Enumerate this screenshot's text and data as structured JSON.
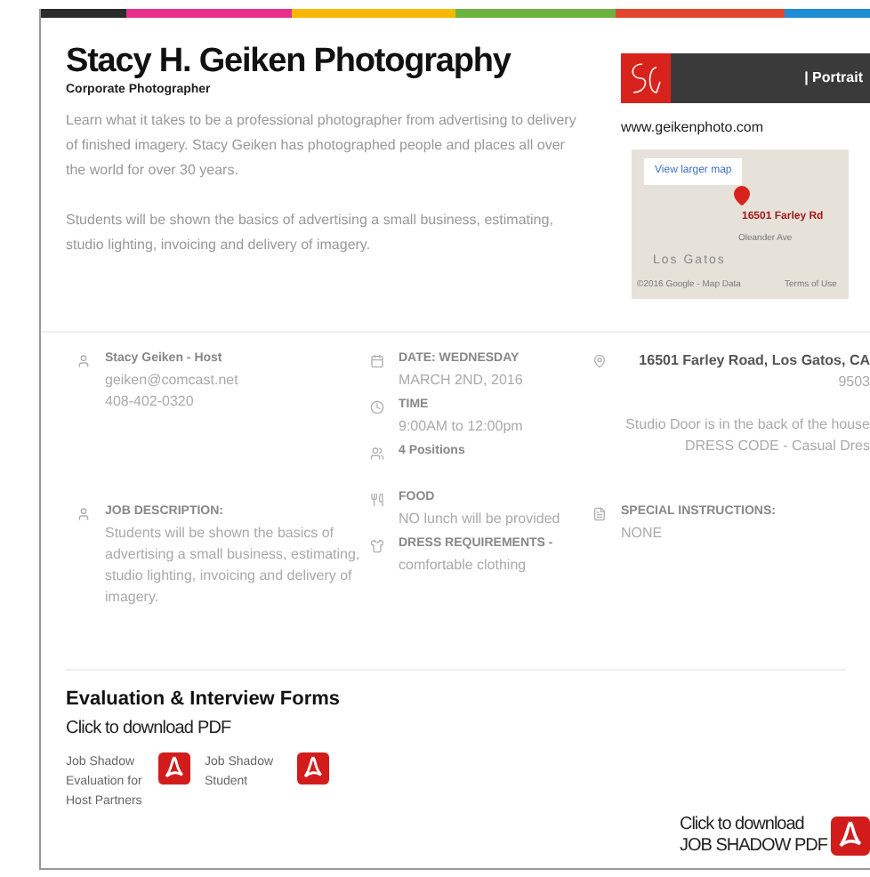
{
  "header": {
    "title": "Stacy H. Geiken Photography",
    "subtitle": "Corporate Photographer"
  },
  "intro": [
    "Learn what it takes to be a professional photographer from advertising to delivery of finished imagery.  Stacy Geiken has photographed people and places all over the world for over 30 years.",
    "Students will be shown the basics of advertising a small business, estimating, studio lighting, invoicing and delivery of imagery."
  ],
  "banner": {
    "tagline": "| Portrait"
  },
  "website": "www.geikenphoto.com",
  "map": {
    "link": "View larger map",
    "pin_label": "16501 Farley Rd",
    "street": "Oleander Ave",
    "town": "Los Gatos",
    "attribution": "©2016 Google - Map Data",
    "terms": "Terms of Use"
  },
  "details": [
    {
      "items": [
        {
          "kind": "person",
          "heading": "Stacy Geiken - Host",
          "lines": [
            "geiken@comcast.net",
            "408-402-0320"
          ]
        },
        {
          "kind": "person",
          "heading": "JOB DESCRIPTION:",
          "lines": [
            "Students will be shown the basics of advertising a small business, estimating, studio lighting, invoicing and delivery of imagery."
          ]
        }
      ]
    },
    {
      "items": [
        {
          "kind": "calendar",
          "heading": "DATE: WEDNESDAY",
          "lines": [
            "MARCH 2ND, 2016"
          ]
        },
        {
          "kind": "clock",
          "heading": "TIME",
          "lines": [
            "9:00AM to 12:00pm"
          ]
        },
        {
          "kind": "people",
          "heading": "4 Positions"
        },
        {
          "kind": "food",
          "heading": "FOOD",
          "lines": [
            "NO lunch will be provided"
          ]
        },
        {
          "kind": "shirt",
          "heading": "DRESS REQUIREMENTS -",
          "lines": [
            "comfortable clothing"
          ]
        }
      ]
    },
    {
      "items": [
        {
          "kind": "pin",
          "heading": "16501 Farley Road, Los Gatos, CA",
          "lines": [
            "9503",
            "Studio Door is in the back of the house",
            "DRESS CODE - Casual Dres"
          ]
        },
        {
          "kind": "note",
          "heading": "SPECIAL INSTRUCTIONS:",
          "lines": [
            "NONE"
          ]
        }
      ]
    }
  ],
  "forms": {
    "title": "Evaluation & Interview Forms",
    "subtitle": "Click to download PDF",
    "files": [
      "Job Shadow Evaluation for Host Partners",
      "Job Shadow Student"
    ]
  },
  "download": {
    "line_1": "Click to download",
    "line_2": "JOB SHADOW PDF"
  }
}
